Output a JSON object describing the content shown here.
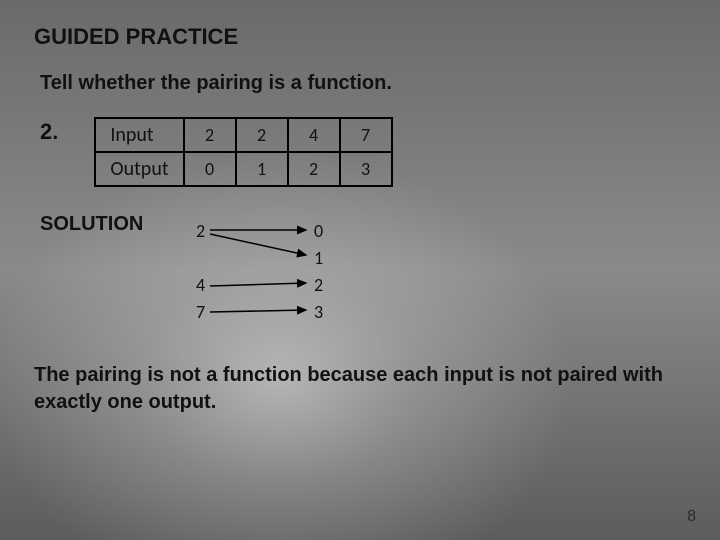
{
  "heading": "GUIDED PRACTICE",
  "prompt": "Tell whether the pairing is a function.",
  "question_number": "2.",
  "table": {
    "row_labels": [
      "Input",
      "Output"
    ],
    "inputs": [
      "2",
      "2",
      "4",
      "7"
    ],
    "outputs": [
      "0",
      "1",
      "2",
      "3"
    ]
  },
  "solution_label": "SOLUTION",
  "mapping": {
    "left": [
      "2",
      "4",
      "7"
    ],
    "right": [
      "0",
      "1",
      "2",
      "3"
    ]
  },
  "conclusion": "The pairing is not a function because each input is not paired with exactly one output.",
  "page_number": "8"
}
